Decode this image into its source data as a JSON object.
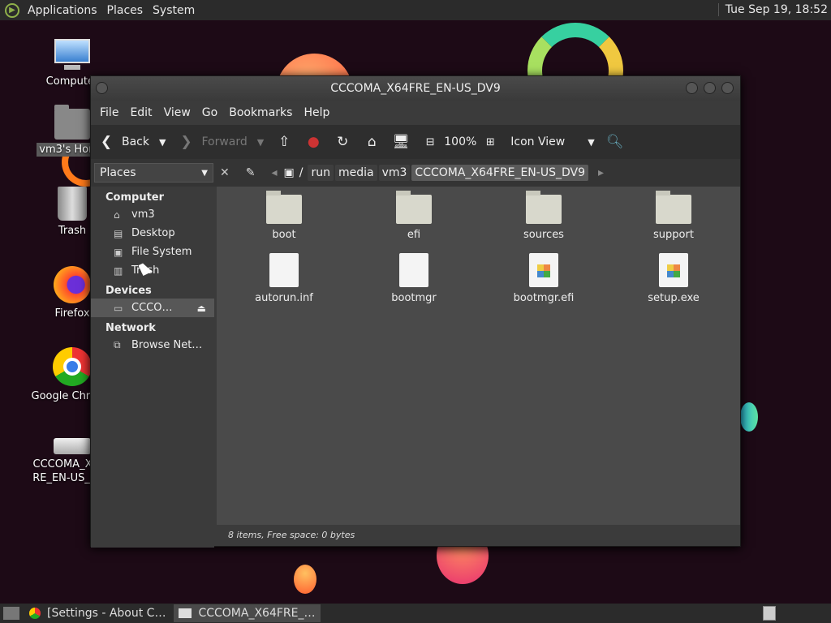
{
  "top_panel": {
    "menus": [
      "Applications",
      "Places",
      "System"
    ],
    "clock": "Tue Sep 19, 18:52"
  },
  "desktop_icons": [
    {
      "label": "Computer",
      "icon": "computer-icon"
    },
    {
      "label": "vm3's Home",
      "icon": "home-folder-icon"
    },
    {
      "label": "Trash",
      "icon": "trash-icon"
    },
    {
      "label": "Firefox",
      "icon": "firefox-icon"
    },
    {
      "label": "Google Chrome",
      "icon": "chrome-icon"
    },
    {
      "label": "CCCOMA_X64FRE_EN-US_DV9",
      "icon": "drive-icon"
    }
  ],
  "window": {
    "title": "CCCOMA_X64FRE_EN-US_DV9",
    "menu": [
      "File",
      "Edit",
      "View",
      "Go",
      "Bookmarks",
      "Help"
    ],
    "toolbar": {
      "back": "Back",
      "forward": "Forward",
      "zoom": "100%",
      "view_mode": "Icon View"
    },
    "places_label": "Places",
    "breadcrumbs": [
      "run",
      "media",
      "vm3",
      "CCCOMA_X64FRE_EN-US_DV9"
    ],
    "sidebar": {
      "computer_header": "Computer",
      "computer_items": [
        "vm3",
        "Desktop",
        "File System",
        "Trash"
      ],
      "devices_header": "Devices",
      "devices_items": [
        "CCCO…"
      ],
      "network_header": "Network",
      "network_items": [
        "Browse Net…"
      ]
    },
    "files": [
      {
        "name": "boot",
        "type": "folder"
      },
      {
        "name": "efi",
        "type": "folder"
      },
      {
        "name": "sources",
        "type": "folder"
      },
      {
        "name": "support",
        "type": "folder"
      },
      {
        "name": "autorun.inf",
        "type": "document"
      },
      {
        "name": "bootmgr",
        "type": "document"
      },
      {
        "name": "bootmgr.efi",
        "type": "executable"
      },
      {
        "name": "setup.exe",
        "type": "executable"
      }
    ],
    "status": "8 items, Free space: 0 bytes"
  },
  "taskbar": {
    "tasks": [
      "[Settings - About C…",
      "CCCOMA_X64FRE_…"
    ]
  }
}
